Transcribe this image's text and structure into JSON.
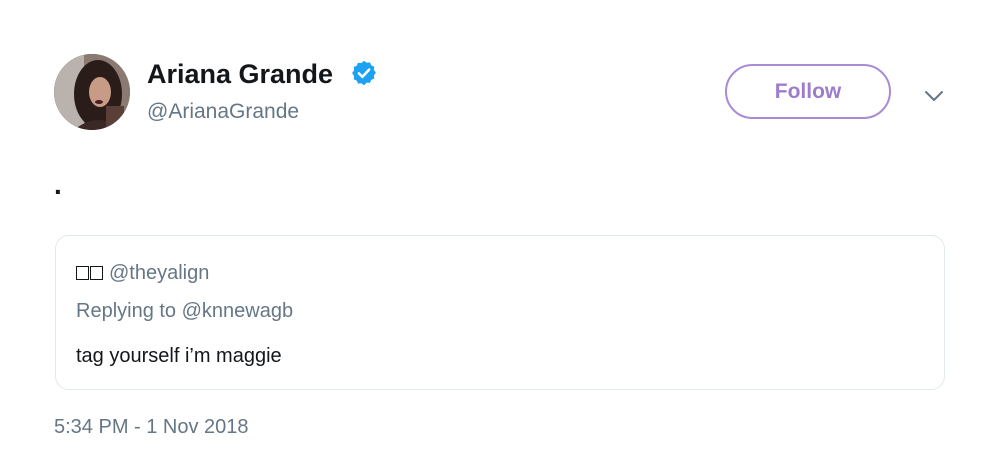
{
  "tweet": {
    "author": {
      "display_name": "Ariana Grande",
      "handle": "@ArianaGrande",
      "verified": true,
      "avatar_icon": "profile-photo"
    },
    "follow_label": "Follow",
    "text": ".",
    "timestamp": "5:34 PM - 1 Nov 2018",
    "quoted": {
      "author_handle": "@theyalign",
      "name_glyphs": "□□",
      "replying_to": "Replying to @knnewagb",
      "text": "tag yourself i’m maggie"
    }
  },
  "colors": {
    "verified": "#1da1f2",
    "follow": "#9d7ccd",
    "secondary_text": "#657786",
    "border": "#e1e8ed"
  },
  "icons": {
    "verified": "verified-badge-icon",
    "more": "chevron-down-icon"
  }
}
